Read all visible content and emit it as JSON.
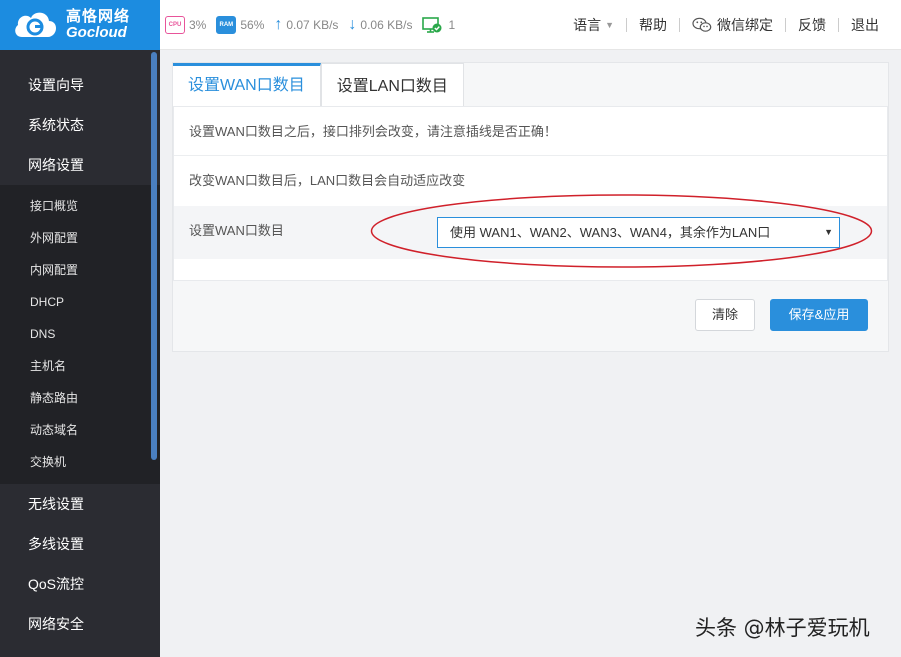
{
  "brand": {
    "name_cn": "高恪网络",
    "name_en": "Gocloud"
  },
  "status": {
    "cpu_label": "CPU",
    "cpu": "3%",
    "ram_label": "RAM",
    "ram": "56%",
    "upload": "0.07 KB/s",
    "download": "0.06 KB/s",
    "devices": "1"
  },
  "header_links": {
    "language": "语言",
    "help": "帮助",
    "wechat": "微信绑定",
    "feedback": "反馈",
    "logout": "退出"
  },
  "sidebar": {
    "items_top": [
      "设置向导",
      "系统状态",
      "网络设置"
    ],
    "sub_items": [
      "接口概览",
      "外网配置",
      "内网配置",
      "DHCP",
      "DNS",
      "主机名",
      "静态路由",
      "动态域名",
      "交换机"
    ],
    "items_bottom": [
      "无线设置",
      "多线设置",
      "QoS流控",
      "网络安全"
    ]
  },
  "tabs": [
    "设置WAN口数目",
    "设置LAN口数目"
  ],
  "content": {
    "notice": "设置WAN口数目之后，接口排列会改变，请注意插线是否正确！",
    "hint": "改变WAN口数目后，LAN口数目会自动适应改变",
    "field_label": "设置WAN口数目",
    "select_value": "使用 WAN1、WAN2、WAN3、WAN4，其余作为LAN口"
  },
  "buttons": {
    "clear": "清除",
    "save": "保存&应用"
  },
  "watermark": "头条 @林子爱玩机",
  "colors": {
    "accent": "#2a8fdc",
    "sidebar": "#2b2c32",
    "annotation": "#d0202a"
  }
}
